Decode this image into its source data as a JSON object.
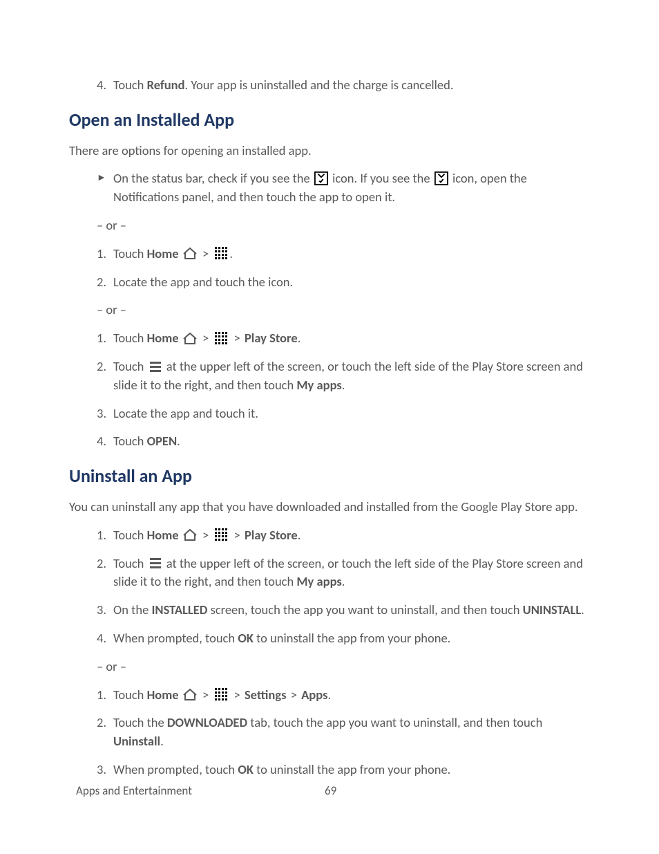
{
  "step4_top": {
    "num": "4.",
    "pre": "Touch ",
    "b": "Refund",
    "post": ". Your app is uninstalled and the charge is cancelled."
  },
  "h2a": "Open an Installed App",
  "p1": "There are options for opening an installed app.",
  "bullet1": {
    "pre": "On the status bar, check if you see the ",
    "mid": " icon. If you see the ",
    "post": " icon, open the Notifications panel, and then touch the app to open it."
  },
  "or": "– or –",
  "blockA": {
    "s1": {
      "num": "1.",
      "pre": "Touch ",
      "b": "Home",
      "post": "."
    },
    "s2": {
      "num": "2.",
      "txt": "Locate the app and touch the icon."
    }
  },
  "blockB": {
    "s1": {
      "num": "1.",
      "pre": "Touch ",
      "b1": "Home",
      "b2": "Play Store",
      "post": "."
    },
    "s2": {
      "num": "2.",
      "pre": "Touch ",
      "mid": " at the upper left of the screen, or touch the left side of the Play Store screen and slide it to the right, and then touch ",
      "b": "My apps",
      "post": "."
    },
    "s3": {
      "num": "3.",
      "txt": "Locate the app and touch it."
    },
    "s4": {
      "num": "4.",
      "pre": "Touch ",
      "b": "OPEN",
      "post": "."
    }
  },
  "h2b": "Uninstall an App",
  "p2": "You can uninstall any app that you have downloaded and installed from the Google Play Store app.",
  "blockC": {
    "s1": {
      "num": "1.",
      "pre": "Touch ",
      "b1": "Home",
      "b2": "Play Store",
      "post": "."
    },
    "s2": {
      "num": "2.",
      "pre": "Touch ",
      "mid": " at the upper left of the screen, or touch the left side of the Play Store screen and slide it to the right, and then touch ",
      "b": "My apps",
      "post": "."
    },
    "s3": {
      "num": "3.",
      "pre": "On the ",
      "b1": "INSTALLED",
      "mid": " screen, touch the app you want to uninstall, and then touch ",
      "b2": "UNINSTALL",
      "post": "."
    },
    "s4": {
      "num": "4.",
      "pre": "When prompted, touch ",
      "b": "OK",
      "post": " to uninstall the app from your phone."
    }
  },
  "blockD": {
    "s1": {
      "num": "1.",
      "pre": "Touch ",
      "b1": "Home",
      "b2": "Settings",
      "b3": "Apps",
      "post": "."
    },
    "s2": {
      "num": "2.",
      "pre": "Touch the ",
      "b1": "DOWNLOADED",
      "mid": " tab, touch the app you want to uninstall, and then touch ",
      "b2": "Uninstall",
      "post": "."
    },
    "s3": {
      "num": "3.",
      "pre": "When prompted, touch ",
      "b": "OK",
      "post": " to uninstall the app from your phone."
    }
  },
  "footer": {
    "section": "Apps and Entertainment",
    "page": "69"
  },
  "sep": ">"
}
